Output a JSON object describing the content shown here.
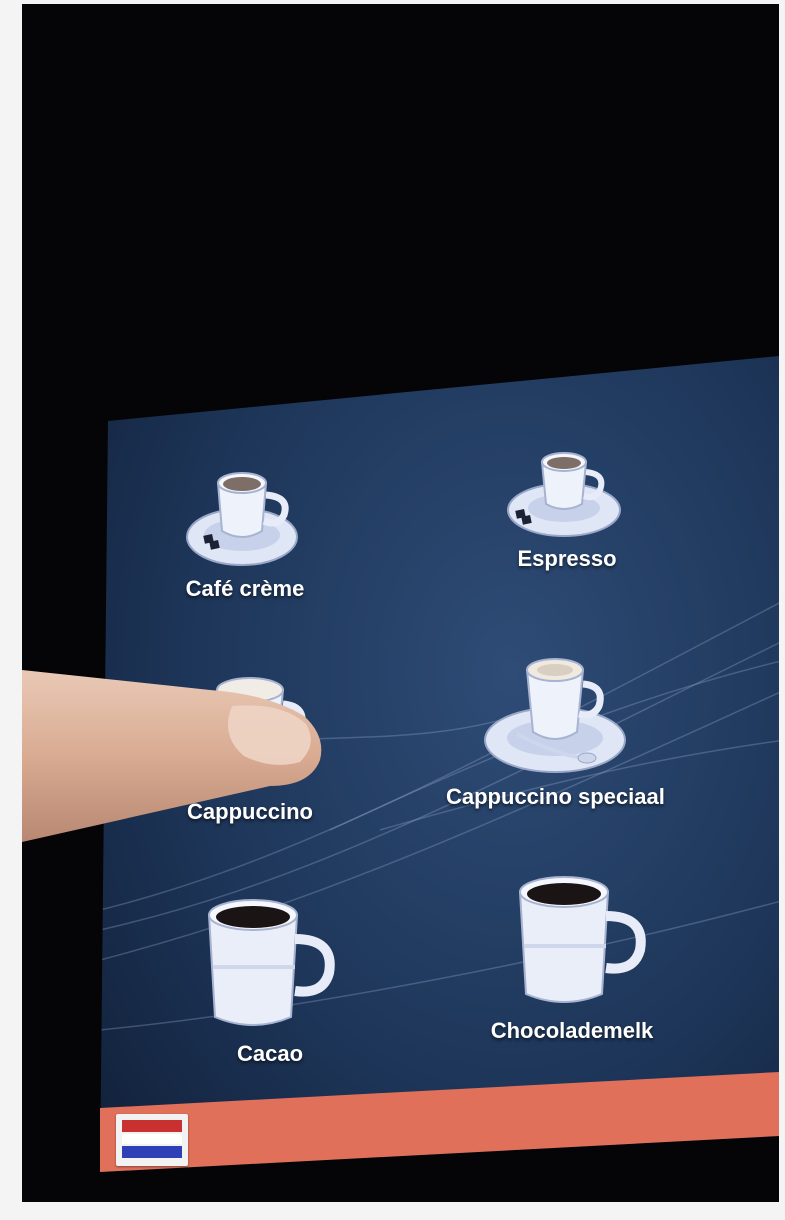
{
  "drinks": [
    {
      "label": "Café crème",
      "icon": "cafe-creme-cup-icon"
    },
    {
      "label": "Espresso",
      "icon": "espresso-cup-icon"
    },
    {
      "label": "Cappuccino",
      "icon": "cappuccino-cup-icon"
    },
    {
      "label": "Cappuccino speciaal",
      "icon": "cappuccino-speciaal-cup-icon"
    },
    {
      "label": "Cacao",
      "icon": "cacao-mug-icon"
    },
    {
      "label": "Chocolademelk",
      "icon": "chocolademelk-mug-icon"
    }
  ],
  "language": {
    "flag": "netherlands-flag-icon",
    "colors": [
      "#c8312f",
      "#ffffff",
      "#2f3fb5"
    ]
  },
  "colors": {
    "screen_bg": "#1d3558",
    "language_bar": "#e0705a",
    "bezel": "#050507"
  }
}
